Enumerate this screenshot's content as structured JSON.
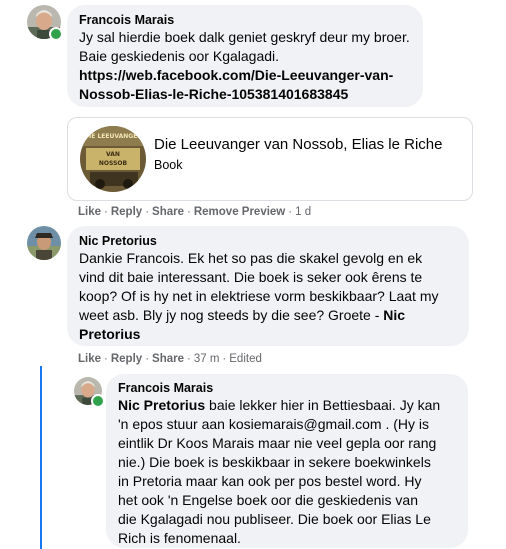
{
  "comments": [
    {
      "author": "Francois Marais",
      "line1": "Jy sal hierdie boek dalk geniet geskryf deur my broer.",
      "line2": "Baie geskiedenis oor Kgalagadi.",
      "link_line1": "https://web.facebook.com/Die-Leeuvanger-van-",
      "link_line2": "Nossob-Elias-le-Riche-105381401683845",
      "attachment": {
        "title": "Die Leeuvanger van Nossob, Elias le Riche",
        "subtitle": "Book",
        "thumb_lines": [
          "DIE LEEUVANGER",
          "VAN",
          "NOSSOB"
        ]
      },
      "actions": {
        "like": "Like",
        "reply": "Reply",
        "share": "Share",
        "remove_preview": "Remove Preview",
        "time": "1 d"
      }
    },
    {
      "author": "Nic Pretorius",
      "lines": [
        "Dankie Francois. Ek het so pas die skakel gevolg en ek",
        "vind dit baie interessant. Die boek is seker ook êrens te",
        "koop? Of is hy net in elektriese vorm beskikbaar? Laat my",
        "weet asb. Bly jy nog steeds by die see? Groete - "
      ],
      "mention_part1": "Nic",
      "mention_part2": "Pretorius",
      "actions": {
        "like": "Like",
        "reply": "Reply",
        "share": "Share",
        "time": "37 m",
        "edited": "Edited"
      }
    },
    {
      "author": "Francois Marais",
      "mention": "Nic Pretorius",
      "first_line_rest": " baie lekker hier in Bettiesbaai. Jy kan",
      "lines": [
        "'n epos stuur aan kosiemarais@gmail.com . (Hy is",
        "eintlik Dr Koos Marais maar nie veel gepla oor rang",
        "nie.) Die boek is beskikbaar in sekere boekwinkels",
        "in Pretoria maar kan ook per pos bestel word. Hy",
        "het ook 'n Engelse boek oor die geskiedenis van",
        "die Kgalagadi nou publiseer. Die boek oor Elias Le",
        "Rich is fenomenaal."
      ]
    }
  ],
  "colors": {
    "bubble": "#f0f2f5",
    "meta_text": "#65676b",
    "online": "#31a24c",
    "thread_line": "#1877f2"
  }
}
